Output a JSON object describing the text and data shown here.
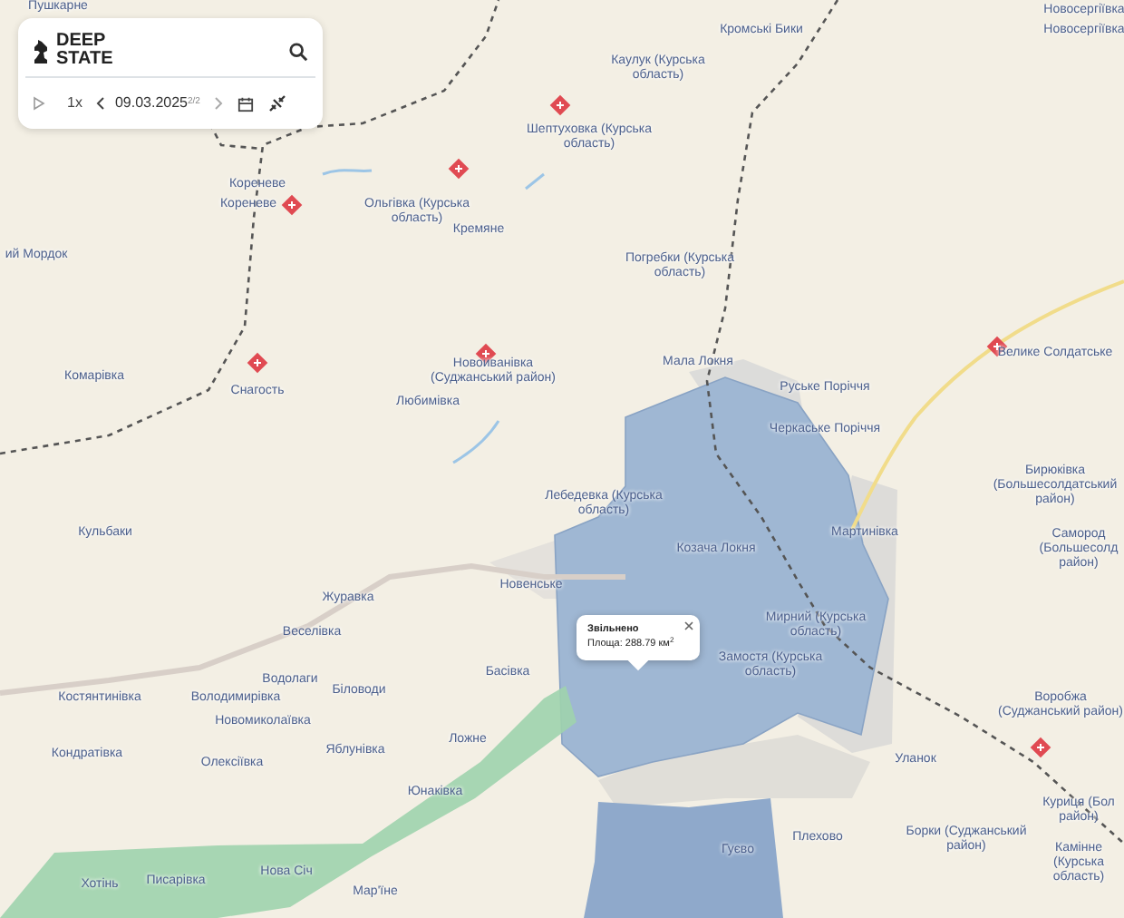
{
  "panel": {
    "logo": "DEEP STATE",
    "speed": "1x",
    "date": "09.03.2025",
    "date_index": "2/2"
  },
  "popup": {
    "title": "Звільнено",
    "area": "Площа: 288.79 км$^{2}$"
  },
  "labels": [
    "Пушкарне",
    "Кромські Бики",
    "Новосергіївка",
    "Новосергіївка",
    "Каулук (Курська область)",
    "Шептуховка (Курська область)",
    "Кореневе",
    "Кореневе",
    "Ольгівка (Курська область)",
    "Кремяне",
    "ий Мордок",
    "Погребки (Курська область)",
    "Комарівка",
    "Снагость",
    "Новоиванівка (Суджанський район)",
    "Любимівка",
    "Мала Локня",
    "Руське Поріччя",
    "Черкаське Поріччя",
    "Велике Солдатське",
    "Кульбаки",
    "Лебедевка (Курська область)",
    "Козача Локня",
    "Мартинівка",
    "Бирюківка (Большесолдатський район)",
    "Самород (Большесолд район)",
    "Новенське",
    "Журавка",
    "Веселівка",
    "Водолаги",
    "Біловоди",
    "Костянтинівка",
    "Володимирівка",
    "Новомиколаївка",
    "Басівка",
    "Мирний (Курська область)",
    "Замостя (Курська область)",
    "Кондратівка",
    "Олексіївка",
    "Яблунівка",
    "Ложне",
    "Юнаківка",
    "Уланок",
    "Воробжа (Суджанський район)",
    "Куриця (Бол район)",
    "Плехово",
    "Гуєво",
    "Борки (Суджанський район)",
    "Камінне (Курська область)",
    "Хотінь",
    "Писарівка",
    "Нова Січ",
    "Мар'їне"
  ]
}
